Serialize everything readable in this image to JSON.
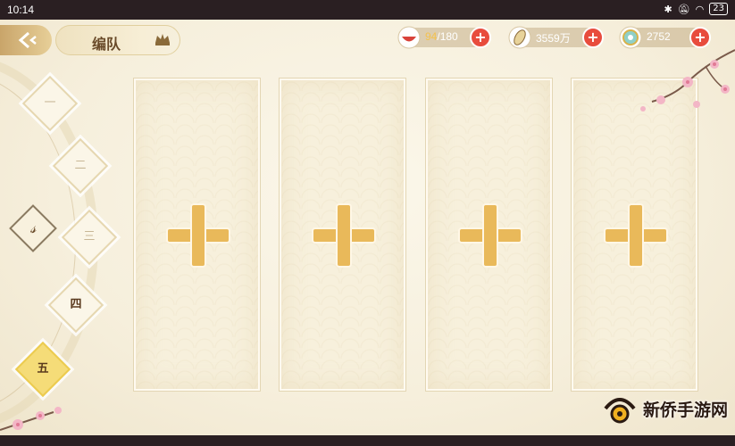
{
  "status_bar": {
    "time": "10:14",
    "battery": "23"
  },
  "header": {
    "title": "编队"
  },
  "resources": [
    {
      "name": "stamina",
      "value_highlight": "94",
      "value_rest": "/180",
      "icon": "bowl-icon"
    },
    {
      "name": "currency",
      "value_highlight": "",
      "value_rest": "3559万",
      "icon": "coin-icon"
    },
    {
      "name": "jade",
      "value_highlight": "",
      "value_rest": "2752",
      "icon": "jade-icon"
    }
  ],
  "tabs": [
    {
      "label": "一",
      "state": "inactive"
    },
    {
      "label": "二",
      "state": "inactive"
    },
    {
      "label": "三",
      "state": "inactive"
    },
    {
      "label": "四",
      "state": "dark"
    },
    {
      "label": "五",
      "state": "active"
    }
  ],
  "dial_mark": "𝓈",
  "slots": [
    "empty",
    "empty",
    "empty",
    "empty"
  ],
  "watermark": {
    "text": "新侨手游网"
  },
  "colors": {
    "accent_gold": "#e9b95a",
    "plus_red": "#e84c3d",
    "active_tab": "#f5dc78"
  }
}
